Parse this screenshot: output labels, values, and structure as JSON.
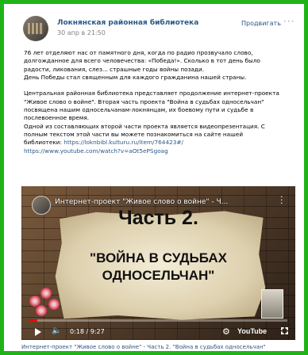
{
  "post": {
    "author": "Локнянская районная библиотека",
    "date": "30 апр в 21:50",
    "promote_label": "Продвигать",
    "more_label": "···"
  },
  "text_lines": [
    "76 лет отделяют нас от памятного дня, когда по радио прозвучало слово,",
    "долгожданное для всего человечества: «Победа!». Сколько в тот день было",
    "радости, ликования, слез... страшные годы войны позади.",
    "День Победы стал священным для каждого гражданина нашей страны.",
    "",
    "Центральная районная библиотека представляет продолжение интернет-проекта",
    "\"Живое слово о войне\". Вторая часть проекта \"Война в судьбах односельчан\"",
    "посвящена нашим односельчанам-локнянцам, их боевому пути и судьбе в",
    "послевоенное время.",
    "Одной из составляющих второй части проекта является видеопрезентация. С",
    "полным текстом этой части вы можете познакомиться на сайте нашей"
  ],
  "link_line_prefix": "библиотеки: ",
  "link1": "https://loknbibl.kulturu.ru/item/764423#/",
  "link2": "https://www.youtube.com/watch?v=aOt5ePSgoag",
  "video": {
    "title": "Интернет-проект \"Живое слово о войне\" - Ч...",
    "heading": "Часть 2.",
    "subheading_line1": "\"ВОЙНА В СУДЬБАХ",
    "subheading_line2": "ОДНОСЕЛЬЧАН\"",
    "time": "0:18 / 9:27",
    "progress": 0.03,
    "brand": "YouTube"
  },
  "caption": "Интернет-проект \"Живое слово о войне\" - Часть 2. \"Война в судьбах односельчан\"",
  "colors": {
    "frame": "#1fb318",
    "link": "#2a5885",
    "progress": "#ff0000"
  }
}
